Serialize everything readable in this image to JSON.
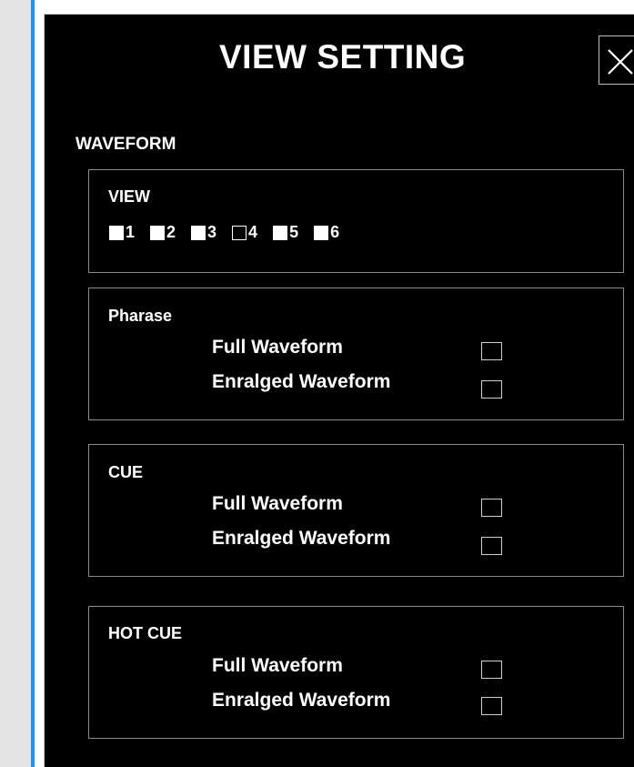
{
  "dialog": {
    "title": "VIEW SETTING",
    "close_icon": "close-icon"
  },
  "section": {
    "label": "WAVEFORM"
  },
  "view_group": {
    "title": "VIEW",
    "items": [
      {
        "label": "1",
        "checked": true
      },
      {
        "label": "2",
        "checked": true
      },
      {
        "label": "3",
        "checked": true
      },
      {
        "label": "4",
        "checked": false
      },
      {
        "label": "5",
        "checked": true
      },
      {
        "label": "6",
        "checked": true
      }
    ]
  },
  "groups": [
    {
      "title": "Pharase",
      "options": [
        {
          "label": "Full Waveform",
          "checked": false
        },
        {
          "label": "Enralged Waveform",
          "checked": false
        }
      ]
    },
    {
      "title": "CUE",
      "options": [
        {
          "label": "Full Waveform",
          "checked": false
        },
        {
          "label": "Enralged Waveform",
          "checked": false
        }
      ]
    },
    {
      "title": "HOT CUE",
      "options": [
        {
          "label": "Full Waveform",
          "checked": false
        },
        {
          "label": "Enralged Waveform",
          "checked": false
        }
      ]
    }
  ],
  "colors": {
    "accent": "#1e90ff",
    "dialog_bg": "#000000",
    "text": "#ffffff"
  }
}
